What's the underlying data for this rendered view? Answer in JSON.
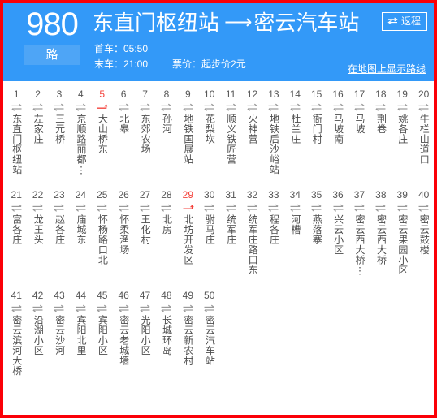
{
  "header": {
    "route_number": "980",
    "route_unit": "路",
    "origin": "东直门枢纽站",
    "direction_arrow": "⟶",
    "destination": "密云汽车站",
    "return_button_label": "返程",
    "return_button_icon": "swap-arrows-icon",
    "first_bus_label": "首车：05:50",
    "last_bus_label": "末车：21:00",
    "fare_label": "票价：起步价2元",
    "map_link_label": "在地图上显示路线",
    "accent_color": "#3399f8",
    "badge_color": "#4ea5f6",
    "border_color": "#fb0007"
  },
  "stations": {
    "highlight_color": "#f4433c",
    "normal_color": "#555555",
    "items": [
      {
        "num": "1",
        "name": "东直门枢纽站",
        "icon": "two-way-arrow-icon",
        "highlighted": false
      },
      {
        "num": "2",
        "name": "左家庄",
        "icon": "two-way-arrow-icon",
        "highlighted": false
      },
      {
        "num": "3",
        "name": "三元桥",
        "icon": "two-way-arrow-icon",
        "highlighted": false
      },
      {
        "num": "4",
        "name": "京顺路丽都⋮",
        "icon": "two-way-arrow-icon",
        "highlighted": false
      },
      {
        "num": "5",
        "name": "大山桥东",
        "icon": "one-way-arrow-icon",
        "highlighted": true
      },
      {
        "num": "6",
        "name": "北皋",
        "icon": "two-way-arrow-icon",
        "highlighted": false
      },
      {
        "num": "7",
        "name": "东郊农场",
        "icon": "two-way-arrow-icon",
        "highlighted": false
      },
      {
        "num": "8",
        "name": "孙河",
        "icon": "two-way-arrow-icon",
        "highlighted": false
      },
      {
        "num": "9",
        "name": "地铁国展站",
        "icon": "two-way-arrow-icon",
        "highlighted": false
      },
      {
        "num": "10",
        "name": "花梨坎",
        "icon": "two-way-arrow-icon",
        "highlighted": false
      },
      {
        "num": "11",
        "name": "顺义铁匠营",
        "icon": "two-way-arrow-icon",
        "highlighted": false
      },
      {
        "num": "12",
        "name": "火神营",
        "icon": "two-way-arrow-icon",
        "highlighted": false
      },
      {
        "num": "13",
        "name": "地铁后沙峪站",
        "icon": "two-way-arrow-icon",
        "highlighted": false
      },
      {
        "num": "14",
        "name": "杜兰庄",
        "icon": "two-way-arrow-icon",
        "highlighted": false
      },
      {
        "num": "15",
        "name": "衙门村",
        "icon": "two-way-arrow-icon",
        "highlighted": false
      },
      {
        "num": "16",
        "name": "马坡南",
        "icon": "two-way-arrow-icon",
        "highlighted": false
      },
      {
        "num": "17",
        "name": "马坡",
        "icon": "two-way-arrow-icon",
        "highlighted": false
      },
      {
        "num": "18",
        "name": "荆卷",
        "icon": "two-way-arrow-icon",
        "highlighted": false
      },
      {
        "num": "19",
        "name": "姚各庄",
        "icon": "two-way-arrow-icon",
        "highlighted": false
      },
      {
        "num": "20",
        "name": "牛栏山道口",
        "icon": "two-way-arrow-icon",
        "highlighted": false
      },
      {
        "num": "21",
        "name": "富各庄",
        "icon": "two-way-arrow-icon",
        "highlighted": false
      },
      {
        "num": "22",
        "name": "龙王头",
        "icon": "two-way-arrow-icon",
        "highlighted": false
      },
      {
        "num": "23",
        "name": "赵各庄",
        "icon": "two-way-arrow-icon",
        "highlighted": false
      },
      {
        "num": "24",
        "name": "庙城东",
        "icon": "two-way-arrow-icon",
        "highlighted": false
      },
      {
        "num": "25",
        "name": "怀杨路口北",
        "icon": "two-way-arrow-icon",
        "highlighted": false
      },
      {
        "num": "26",
        "name": "怀柔渔场",
        "icon": "two-way-arrow-icon",
        "highlighted": false
      },
      {
        "num": "27",
        "name": "王化村",
        "icon": "two-way-arrow-icon",
        "highlighted": false
      },
      {
        "num": "28",
        "name": "北房",
        "icon": "two-way-arrow-icon",
        "highlighted": false
      },
      {
        "num": "29",
        "name": "北坊开发区",
        "icon": "one-way-arrow-icon",
        "highlighted": true
      },
      {
        "num": "30",
        "name": "驸马庄",
        "icon": "two-way-arrow-icon",
        "highlighted": false
      },
      {
        "num": "31",
        "name": "统军庄",
        "icon": "two-way-arrow-icon",
        "highlighted": false
      },
      {
        "num": "32",
        "name": "统军庄路口东",
        "icon": "two-way-arrow-icon",
        "highlighted": false
      },
      {
        "num": "33",
        "name": "程各庄",
        "icon": "two-way-arrow-icon",
        "highlighted": false
      },
      {
        "num": "34",
        "name": "河槽",
        "icon": "two-way-arrow-icon",
        "highlighted": false
      },
      {
        "num": "35",
        "name": "燕落寨",
        "icon": "two-way-arrow-icon",
        "highlighted": false
      },
      {
        "num": "36",
        "name": "兴云小区",
        "icon": "two-way-arrow-icon",
        "highlighted": false
      },
      {
        "num": "37",
        "name": "密云西大桥⋮",
        "icon": "two-way-arrow-icon",
        "highlighted": false
      },
      {
        "num": "38",
        "name": "密云西大桥",
        "icon": "two-way-arrow-icon",
        "highlighted": false
      },
      {
        "num": "39",
        "name": "密云果园小区",
        "icon": "two-way-arrow-icon",
        "highlighted": false
      },
      {
        "num": "40",
        "name": "密云鼓楼",
        "icon": "two-way-arrow-icon",
        "highlighted": false
      },
      {
        "num": "41",
        "name": "密云滨河大桥",
        "icon": "two-way-arrow-icon",
        "highlighted": false
      },
      {
        "num": "42",
        "name": "沿湖小区",
        "icon": "two-way-arrow-icon",
        "highlighted": false
      },
      {
        "num": "43",
        "name": "密云沙河",
        "icon": "two-way-arrow-icon",
        "highlighted": false
      },
      {
        "num": "44",
        "name": "宾阳北里",
        "icon": "two-way-arrow-icon",
        "highlighted": false
      },
      {
        "num": "45",
        "name": "宾阳小区",
        "icon": "two-way-arrow-icon",
        "highlighted": false
      },
      {
        "num": "46",
        "name": "密云老城墙",
        "icon": "two-way-arrow-icon",
        "highlighted": false
      },
      {
        "num": "47",
        "name": "光阳小区",
        "icon": "two-way-arrow-icon",
        "highlighted": false
      },
      {
        "num": "48",
        "name": "长城环岛",
        "icon": "two-way-arrow-icon",
        "highlighted": false
      },
      {
        "num": "49",
        "name": "密云新农村",
        "icon": "two-way-arrow-icon",
        "highlighted": false
      },
      {
        "num": "50",
        "name": "密云汽车站",
        "icon": "two-way-arrow-icon",
        "highlighted": false
      }
    ]
  }
}
